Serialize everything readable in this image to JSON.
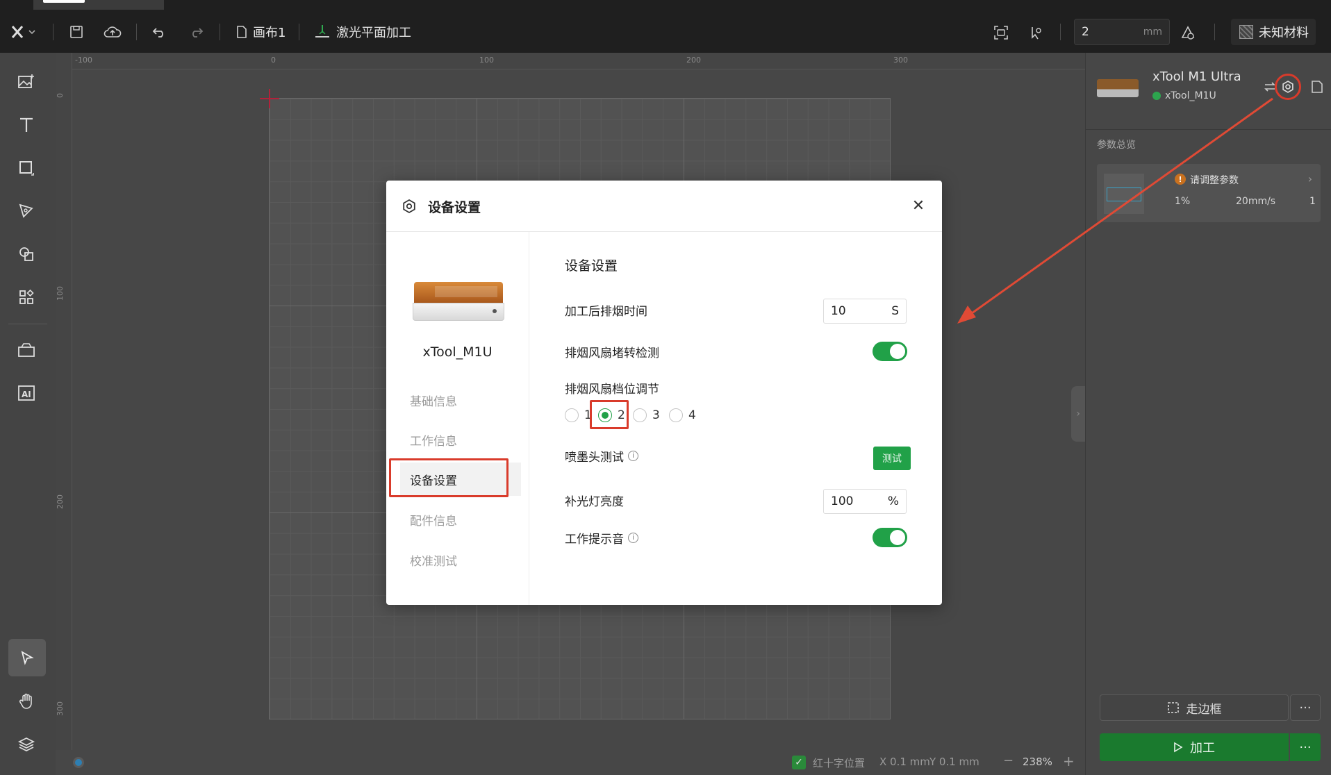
{
  "toolbar": {
    "canvas_name": "画布1",
    "process_mode": "激光平面加工",
    "size_value": "2",
    "size_unit": "mm",
    "material": "未知材料"
  },
  "ruler": {
    "top_ticks": [
      "-100",
      "0",
      "100",
      "200",
      "300"
    ],
    "left_ticks": [
      "0",
      "100",
      "200",
      "300"
    ]
  },
  "status": {
    "crosshair_label": "红十字位置",
    "x_coord": "X 0.1 mm",
    "y_coord": "Y 0.1 mm",
    "zoom": "238%"
  },
  "device": {
    "model": "xTool M1 Ultra",
    "connection_name": "xTool_M1U",
    "connection_color": "#2da44e"
  },
  "params": {
    "title": "参数总览",
    "warning": "请调整参数",
    "power": "1%",
    "speed": "20mm/s",
    "passes": "1"
  },
  "actions": {
    "frame": "走边框",
    "process": "加工"
  },
  "dialog": {
    "title": "设备设置",
    "device_name": "xTool_M1U",
    "nav": [
      "基础信息",
      "工作信息",
      "设备设置",
      "配件信息",
      "校准测试"
    ],
    "section_title": "设备设置",
    "smoke_time_label": "加工后排烟时间",
    "smoke_time_value": "10",
    "smoke_time_unit": "S",
    "fan_block_label": "排烟风扇堵转检测",
    "fan_block_on": true,
    "fan_level_label": "排烟风扇档位调节",
    "fan_levels": [
      "1",
      "2",
      "3",
      "4"
    ],
    "fan_level_selected": "2",
    "nozzle_test_label": "喷墨头测试",
    "nozzle_test_button": "测试",
    "fill_light_label": "补光灯亮度",
    "fill_light_value": "100",
    "fill_light_unit": "%",
    "work_sound_label": "工作提示音",
    "work_sound_on": true,
    "accent_color": "#21a148",
    "highlight_color": "#d93b2b"
  }
}
